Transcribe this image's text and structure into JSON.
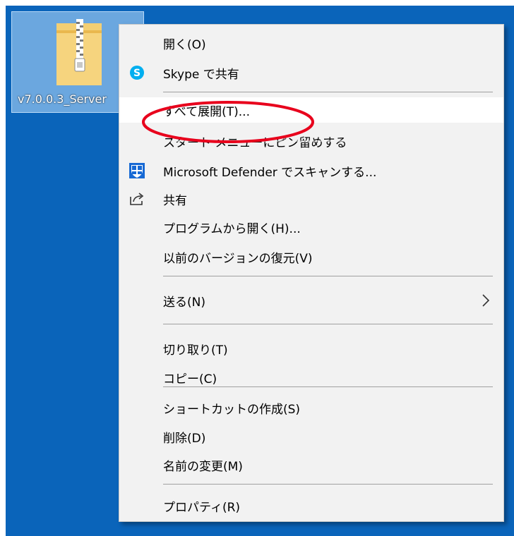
{
  "desktop": {
    "file": {
      "label": "v7.0.0.3_Server"
    }
  },
  "menu": {
    "items": [
      {
        "label": "開く(O)",
        "icon": ""
      },
      {
        "label": "Skype で共有",
        "icon": "skype-icon"
      },
      {
        "label": "すべて展開(T)...",
        "icon": "",
        "state": "highlighted"
      },
      {
        "label": "スタート メニューにピン留めする",
        "icon": ""
      },
      {
        "label": "Microsoft Defender でスキャンする...",
        "icon": "defender-shield-icon"
      },
      {
        "label": "共有",
        "icon": "share-icon"
      },
      {
        "label": "プログラムから開く(H)...",
        "icon": ""
      },
      {
        "label": "以前のバージョンの復元(V)",
        "icon": ""
      },
      {
        "label": "送る(N)",
        "icon": "",
        "submenu": true
      },
      {
        "label": "切り取り(T)",
        "icon": ""
      },
      {
        "label": "コピー(C)",
        "icon": ""
      },
      {
        "label": "ショートカットの作成(S)",
        "icon": ""
      },
      {
        "label": "削除(D)",
        "icon": ""
      },
      {
        "label": "名前の変更(M)",
        "icon": ""
      },
      {
        "label": "プロパティ(R)",
        "icon": ""
      }
    ]
  },
  "colors": {
    "desktop": "#0a64ba",
    "menu_bg": "#f2f2f2",
    "highlight": "#ffffff",
    "annotation": "#e8001c",
    "skype": "#00aff0",
    "defender": "#1769d4"
  }
}
